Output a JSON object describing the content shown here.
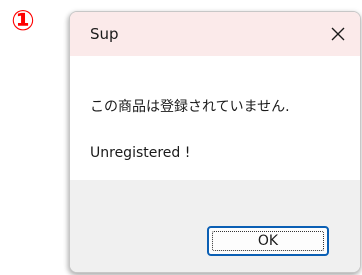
{
  "step_marker": "①",
  "dialog": {
    "title": "Sup",
    "close_icon": "close-icon",
    "message_jp": "この商品は登録されていません.",
    "message_en": "Unregistered !",
    "ok_label": "OK"
  },
  "colors": {
    "titlebar_bg": "#fbeaea",
    "footer_bg": "#f0f0f0",
    "button_border": "#0a5fb4",
    "step_marker": "#ff0000"
  }
}
